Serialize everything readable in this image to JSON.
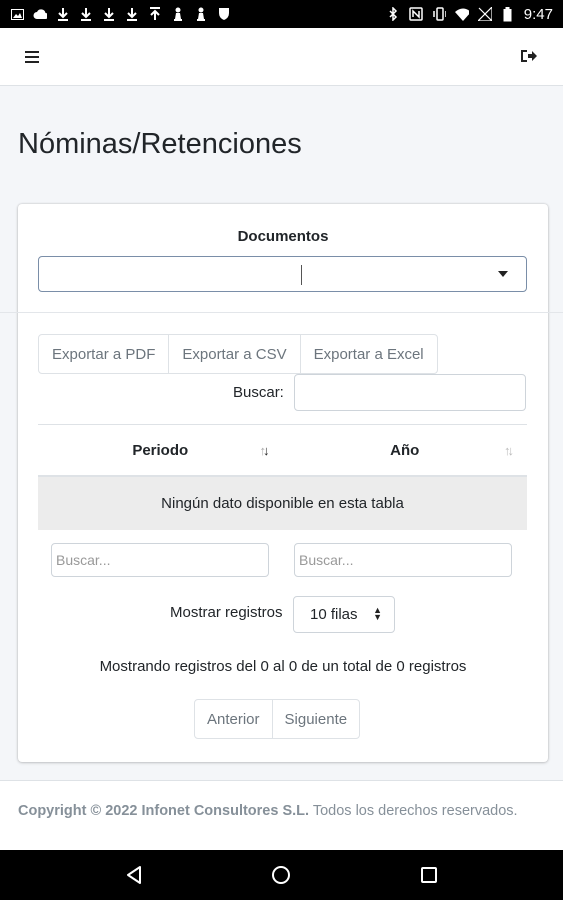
{
  "status_bar": {
    "time": "9:47",
    "left_icons": [
      "image-icon",
      "cloud-icon",
      "download-icon",
      "download-icon",
      "download-icon",
      "download-icon",
      "upload-icon",
      "chess-pawn-icon",
      "chess-pawn-icon",
      "shield-icon"
    ],
    "right_icons": [
      "bluetooth-icon",
      "nfc-icon",
      "vibrate-icon",
      "wifi-icon",
      "signal-icon",
      "battery-icon"
    ]
  },
  "nav": {
    "menu_icon": "hamburger-icon",
    "logout_icon": "sign-out-icon"
  },
  "page": {
    "title": "Nóminas/Retenciones"
  },
  "documents": {
    "label": "Documentos",
    "selected": ""
  },
  "export": {
    "pdf": "Exportar a PDF",
    "csv": "Exportar a CSV",
    "excel": "Exportar a Excel"
  },
  "search": {
    "label": "Buscar:",
    "value": ""
  },
  "table": {
    "columns": [
      "Periodo",
      "Año"
    ],
    "empty_message": "Ningún dato disponible en esta tabla",
    "column_search_placeholders": [
      "Buscar...",
      "Buscar..."
    ]
  },
  "paging": {
    "rows_label": "Mostrar registros",
    "rows_value": "10 filas",
    "info": "Mostrando registros del 0 al 0 de un total de 0 registros",
    "prev": "Anterior",
    "next": "Siguiente"
  },
  "footer": {
    "copyright": "Copyright © 2022 Infonet Consultores S.L.",
    "rights": "Todos los derechos reservados."
  },
  "android_nav": [
    "back-icon",
    "home-icon",
    "recents-icon"
  ]
}
